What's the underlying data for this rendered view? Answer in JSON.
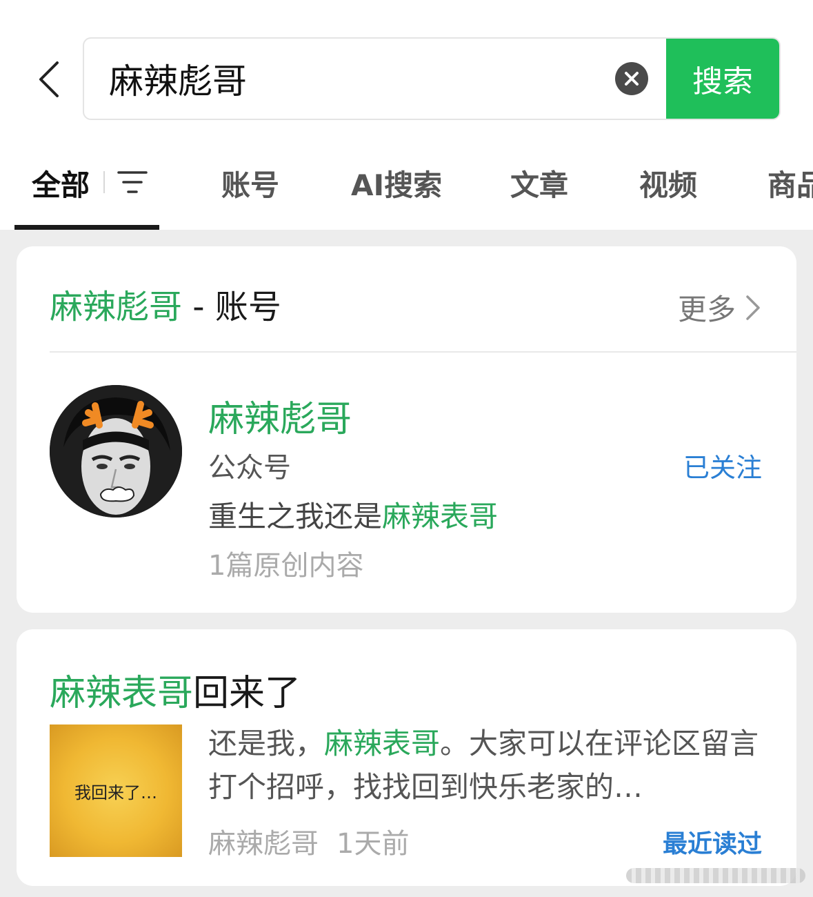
{
  "search": {
    "query": "麻辣彪哥",
    "button_label": "搜索"
  },
  "tabs": [
    {
      "label": "全部"
    },
    {
      "label": "账号"
    },
    {
      "label": "AI搜索"
    },
    {
      "label": "文章"
    },
    {
      "label": "视频"
    },
    {
      "label": "商品"
    }
  ],
  "account_section": {
    "title_highlight": "麻辣彪哥",
    "title_suffix": " - 账号",
    "more_label": "更多",
    "account": {
      "name": "麻辣彪哥",
      "type": "公众号",
      "desc_prefix": "重生之我还是",
      "desc_highlight": "麻辣表哥",
      "original_count": "1篇原创内容",
      "follow_status": "已关注"
    }
  },
  "article": {
    "title_highlight": "麻辣表哥",
    "title_suffix": "回来了",
    "thumbnail_text": "我回来了…",
    "snippet_prefix": "还是我，",
    "snippet_highlight": "麻辣表哥",
    "snippet_suffix": "。大家可以在评论区留言打个招呼，找找回到快乐老家的…",
    "source": "麻辣彪哥",
    "time": "1天前",
    "status": "最近读过"
  },
  "colors": {
    "accent_green": "#1fbf5a",
    "highlight_green": "#2aa85b",
    "link_blue": "#2a7fd4"
  }
}
